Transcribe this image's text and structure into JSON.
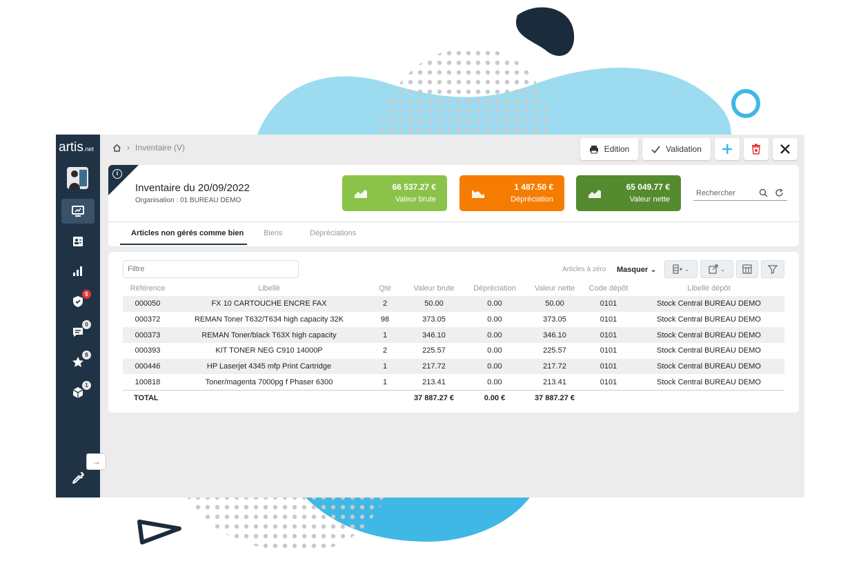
{
  "sidebar": {
    "logo_main": "artis",
    "logo_suffix": ".net",
    "items": [
      {
        "icon": "monitor-icon",
        "active": true
      },
      {
        "icon": "contact-card-icon"
      },
      {
        "icon": "bar-chart-icon"
      },
      {
        "icon": "shield-check-icon",
        "badge": "5",
        "badge_color": "#e53935"
      },
      {
        "icon": "chat-icon",
        "badge": "0"
      },
      {
        "icon": "star-icon",
        "badge": "8"
      },
      {
        "icon": "cube-icon",
        "badge": "1"
      },
      {
        "icon": "wrench-icon"
      }
    ]
  },
  "breadcrumb": {
    "current": "Inventaire (V)"
  },
  "toolbar": {
    "edition_label": "Edition",
    "validation_label": "Validation"
  },
  "header": {
    "title": "Inventaire du 20/09/2022",
    "organisation": "Organisation : 01 BUREAU DEMO",
    "search_placeholder": "Rechercher"
  },
  "kpis": [
    {
      "amount": "66 537.27 €",
      "label": "Valeur brute",
      "color": "#8bc34a"
    },
    {
      "amount": "1 487.50 €",
      "label": "Dépréciation",
      "color": "#f57c00"
    },
    {
      "amount": "65 049.77 €",
      "label": "Valeur nette",
      "color": "#558b2f"
    }
  ],
  "tabs": [
    "Articles non gérés comme bien",
    "Biens",
    "Dépréciations"
  ],
  "table": {
    "filter_placeholder": "Filtre",
    "articles_zero": "Articles à zéro",
    "masquer": "Masquer",
    "columns": [
      "Référence",
      "Libellé",
      "Qté",
      "Valeur brute",
      "Dépréciation",
      "Valeur nette",
      "Code dépôt",
      "Libellé dépôt"
    ],
    "rows": [
      [
        "000050",
        "FX 10 CARTOUCHE ENCRE FAX",
        "2",
        "50.00",
        "0.00",
        "50.00",
        "0101",
        "Stock Central BUREAU DEMO"
      ],
      [
        "000372",
        "REMAN Toner T632/T634 high capacity 32K",
        "98",
        "373.05",
        "0.00",
        "373.05",
        "0101",
        "Stock Central BUREAU DEMO"
      ],
      [
        "000373",
        "REMAN Toner/black T63X high capacity",
        "1",
        "346.10",
        "0.00",
        "346.10",
        "0101",
        "Stock Central BUREAU DEMO"
      ],
      [
        "000393",
        "KIT TONER NEG C910 14000P",
        "2",
        "225.57",
        "0.00",
        "225.57",
        "0101",
        "Stock Central BUREAU DEMO"
      ],
      [
        "000446",
        "HP Laserjet 4345 mfp Print Cartridge",
        "1",
        "217.72",
        "0.00",
        "217.72",
        "0101",
        "Stock Central BUREAU DEMO"
      ],
      [
        "100818",
        "Toner/magenta 7000pg f Phaser 6300",
        "1",
        "213.41",
        "0.00",
        "213.41",
        "0101",
        "Stock Central BUREAU DEMO"
      ]
    ],
    "total": {
      "label": "TOTAL",
      "valeur_brute": "37 887.27 €",
      "depreciation": "0.00 €",
      "valeur_nette": "37 887.27 €"
    }
  },
  "colors": {
    "sidebar": "#1f3345",
    "blob_light": "#9ddcf0",
    "blob_mid": "#3fb8e6",
    "navy": "#1a2b3c"
  }
}
